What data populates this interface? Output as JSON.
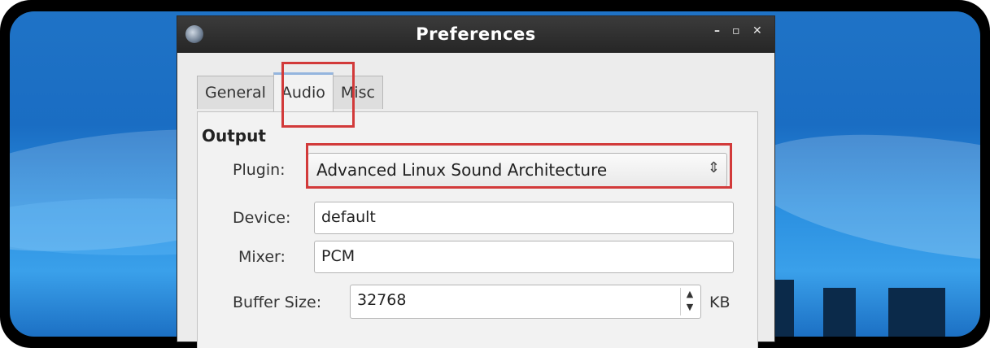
{
  "window": {
    "title": "Preferences",
    "minimize": "–",
    "maximize": "▫",
    "close": "✕"
  },
  "tabs": [
    {
      "label": "General"
    },
    {
      "label": "Audio"
    },
    {
      "label": "Misc"
    }
  ],
  "output": {
    "section_title": "Output",
    "plugin": {
      "label": "Plugin:",
      "value": "Advanced Linux Sound Architecture"
    },
    "device": {
      "label": "Device:",
      "value": "default"
    },
    "mixer": {
      "label": "Mixer:",
      "value": "PCM"
    },
    "buffer": {
      "label": "Buffer Size:",
      "value": "32768",
      "unit": "KB"
    }
  },
  "colors": {
    "annotation": "#d23a3a",
    "titlebar": "#2b2b2b",
    "desktop": "#1f73c6"
  }
}
